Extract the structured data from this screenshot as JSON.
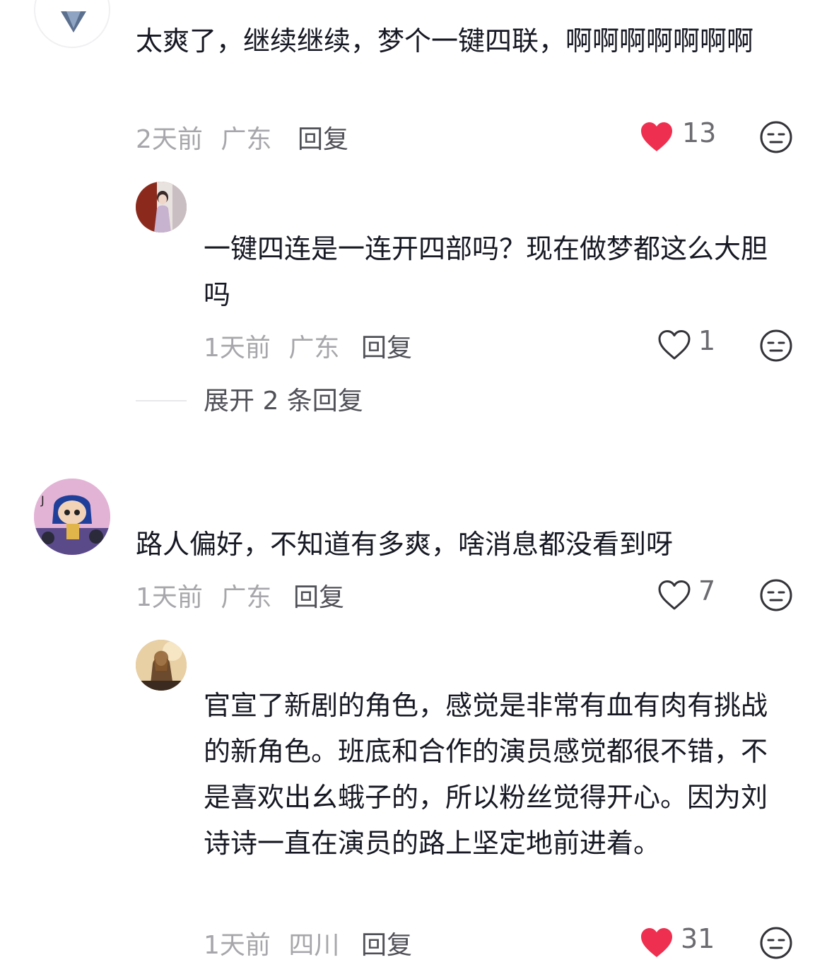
{
  "colors": {
    "liked": "#ef2f4f",
    "text_primary": "#161823",
    "text_meta": "#a7a7ab",
    "text_action": "#505058"
  },
  "comments": [
    {
      "content": "太爽了，继续继续，梦个一键四联，啊啊啊啊啊啊啊",
      "time": "2天前",
      "location": "广东",
      "reply_label": "回复",
      "likes": "13",
      "liked": true,
      "like_icon": "heart-filled-icon",
      "emoji_icon": "neutral-face-icon",
      "replies": [
        {
          "username": "",
          "content": "一键四连是一连开四部吗？现在做梦都这么大胆吗",
          "time": "1天前",
          "location": "广东",
          "reply_label": "回复",
          "likes": "1",
          "liked": false,
          "like_icon": "heart-outline-icon",
          "emoji_icon": "neutral-face-icon"
        }
      ],
      "expand_label": "展开 2 条回复"
    },
    {
      "username": "",
      "content": "路人偏好，不知道有多爽，啥消息都没看到呀",
      "time": "1天前",
      "location": "广东",
      "reply_label": "回复",
      "likes": "7",
      "liked": false,
      "like_icon": "heart-outline-icon",
      "emoji_icon": "neutral-face-icon",
      "replies": [
        {
          "username": "",
          "content": "官宣了新剧的角色，感觉是非常有血有肉有挑战的新角色。班底和合作的演员感觉都很不错，不是喜欢出幺蛾子的，所以粉丝觉得开心。因为刘诗诗一直在演员的路上坚定地前进着。",
          "time": "1天前",
          "location": "四川",
          "reply_label": "回复",
          "likes": "31",
          "liked": true,
          "like_icon": "heart-filled-icon",
          "emoji_icon": "neutral-face-icon"
        }
      ]
    }
  ]
}
